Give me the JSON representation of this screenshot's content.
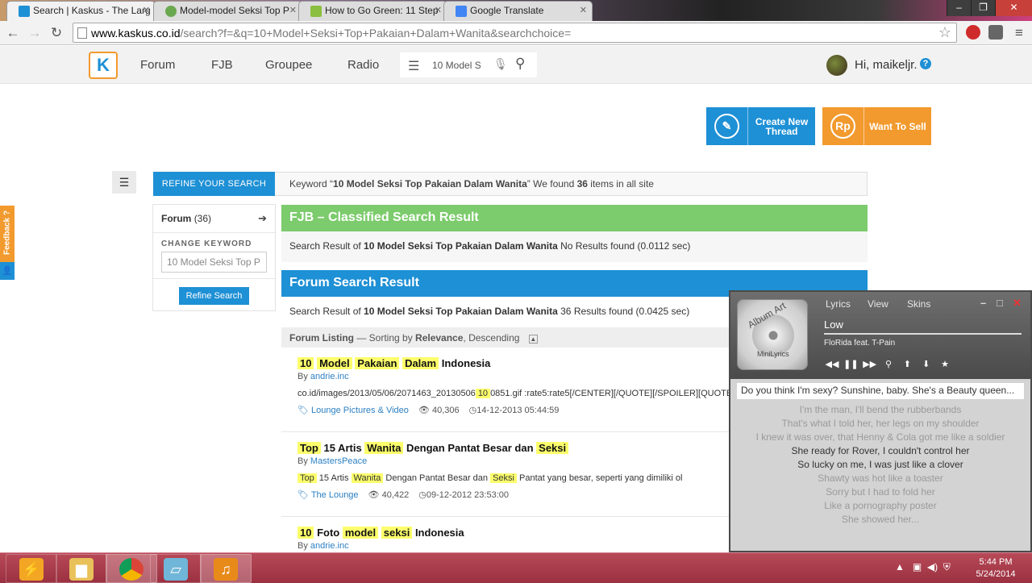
{
  "browser": {
    "tabs": [
      {
        "title": "Search | Kaskus - The Larg",
        "active": true,
        "favicon_color": "#1e90d5"
      },
      {
        "title": "Model-model Seksi Top P",
        "active": false,
        "favicon_color": "#6aa84f"
      },
      {
        "title": "How to Go Green: 11 Step",
        "active": false,
        "favicon_color": "#8bbf3f"
      },
      {
        "title": "Google Translate",
        "active": false,
        "favicon_color": "#4285f4"
      }
    ],
    "url_host": "www.kaskus.co.id",
    "url_path": "/search?f=&q=10+Model+Seksi+Top+Pakaian+Dalam+Wanita&searchchoice="
  },
  "header": {
    "nav": [
      "Forum",
      "FJB",
      "Groupee",
      "Radio"
    ],
    "search_value": "10 Model S",
    "user_greeting": "Hi, maikeljr."
  },
  "actions": {
    "create_thread": "Create New Thread",
    "want_to_sell": "Want To Sell",
    "sell_icon": "Rp"
  },
  "search": {
    "refine_tab": "REFINE YOUR SEARCH",
    "keyword_prefix": "Keyword “",
    "keyword": "10 Model Seksi Top Pakaian Dalam Wanita",
    "keyword_suffix": "” We found ",
    "count": "36",
    "count_suffix": " items in all site"
  },
  "sidebar": {
    "forum_label": "Forum",
    "forum_count": "(36)",
    "change_keyword_label": "CHANGE KEYWORD",
    "keyword_input": "10 Model Seksi Top P",
    "refine_button": "Refine Search"
  },
  "fjb": {
    "title": "FJB – Classified Search Result",
    "result_prefix": "Search Result of ",
    "keyword": "10 Model Seksi Top Pakaian Dalam Wanita",
    "result_suffix": "  No Results found (0.0112 sec)"
  },
  "forum": {
    "title": "Forum Search Result",
    "result_prefix": "Search Result of ",
    "keyword": "10 Model Seksi Top Pakaian Dalam Wanita",
    "result_suffix": " 36 Results found (0.0425 sec)",
    "listing_label": "Forum Listing",
    "sorting_prefix": " — Sorting by ",
    "sorting_value": "Relevance",
    "sorting_suffix": ", Descending"
  },
  "results": [
    {
      "title_parts": [
        {
          "t": "10",
          "hl": true
        },
        {
          "t": " ",
          "hl": false
        },
        {
          "t": "Model",
          "hl": true
        },
        {
          "t": " ",
          "hl": false
        },
        {
          "t": "Pakaian",
          "hl": true
        },
        {
          "t": " ",
          "hl": false
        },
        {
          "t": "Dalam",
          "hl": true
        },
        {
          "t": " Indonesia",
          "hl": false
        }
      ],
      "author": "andrie.inc",
      "snippet_parts": [
        {
          "t": "co.id/images/2013/05/06/2071463_20130506",
          "hl": false
        },
        {
          "t": "10",
          "hl": true
        },
        {
          "t": "0851.gif :rate5:rate5[/CENTER][/QUOTE][/SPOILER][QUOTE]",
          "hl": false
        }
      ],
      "category": "Lounge Pictures & Video",
      "views": "40,306",
      "date": "14-12-2013 05:44:59"
    },
    {
      "title_parts": [
        {
          "t": "Top",
          "hl": true
        },
        {
          "t": " 15 Artis ",
          "hl": false
        },
        {
          "t": "Wanita",
          "hl": true
        },
        {
          "t": " Dengan Pantat Besar dan ",
          "hl": false
        },
        {
          "t": "Seksi",
          "hl": true
        }
      ],
      "author": "MastersPeace",
      "snippet_parts": [
        {
          "t": "Top",
          "hl": true
        },
        {
          "t": " 15 Artis ",
          "hl": false
        },
        {
          "t": "Wanita",
          "hl": true
        },
        {
          "t": " Dengan Pantat Besar dan ",
          "hl": false
        },
        {
          "t": "Seksi",
          "hl": true
        },
        {
          "t": " Pantat yang besar, seperti yang dimiliki ol",
          "hl": false
        }
      ],
      "category": "The Lounge",
      "views": "40,422",
      "date": "09-12-2012 23:53:00"
    },
    {
      "title_parts": [
        {
          "t": "10",
          "hl": true
        },
        {
          "t": " Foto ",
          "hl": false
        },
        {
          "t": "model",
          "hl": true
        },
        {
          "t": " ",
          "hl": false
        },
        {
          "t": "seksi",
          "hl": true
        },
        {
          "t": " Indonesia",
          "hl": false
        }
      ],
      "author": "andrie.inc",
      "snippet_parts": [],
      "category": "",
      "views": "",
      "date": ""
    }
  ],
  "feedback": "Feedback ?",
  "minilyrics": {
    "art_title": "Album Art",
    "art_brand": "MiniLyrics",
    "menu": [
      "Lyrics",
      "View",
      "Skins"
    ],
    "song": "Low",
    "artist": "FloRida feat. T-Pain",
    "current_line": "Do you think I'm sexy? Sunshine, baby. She's a Beauty queen...",
    "lines": [
      {
        "t": "I'm the man, I'll bend the rubberbands",
        "s": "past"
      },
      {
        "t": "That's what I told her, her legs on my shoulder",
        "s": "past"
      },
      {
        "t": "I knew it was over, that Henny & Cola got me like a soldier",
        "s": "past"
      },
      {
        "t": "She ready for Rover, I couldn't control her",
        "s": "near"
      },
      {
        "t": "So lucky on me, I was just like a clover",
        "s": "near"
      },
      {
        "t": "Shawty was hot like a toaster",
        "s": "past"
      },
      {
        "t": "Sorry but I had to fold her",
        "s": "past"
      },
      {
        "t": "Like a pornography poster",
        "s": "past"
      },
      {
        "t": "She showed her...",
        "s": "past"
      }
    ]
  },
  "taskbar": {
    "time": "5:44 PM",
    "date": "5/24/2014"
  }
}
